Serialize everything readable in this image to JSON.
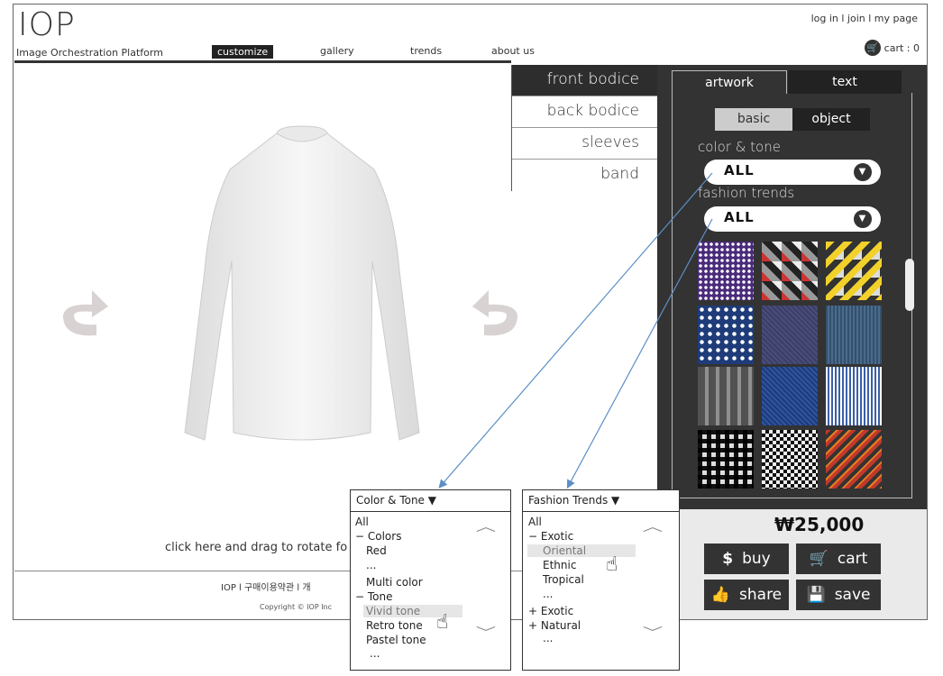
{
  "header": {
    "logo": "IOP",
    "logo_subtitle": "Image Orchestration Platform",
    "top_links": "log in l  join  l  my page",
    "cart_label": "cart : 0",
    "nav": [
      "customize",
      "gallery",
      "trends",
      "about us"
    ]
  },
  "parts": [
    "front bodice",
    "back bodice",
    "sleeves",
    "band"
  ],
  "panel": {
    "tab_artwork": "artwork",
    "tab_text": "text",
    "basic": "basic",
    "object": "object",
    "color_tone_label": "color & tone",
    "color_tone_value": "ALL",
    "fashion_label": "fashion trends",
    "fashion_value": "ALL"
  },
  "price": "₩25,000",
  "actions": {
    "buy": "buy",
    "cart": "cart",
    "share": "share",
    "save": "save"
  },
  "hint": "click here and drag to rotate fo",
  "footer": {
    "links": "IOP   l   구매이용약관   l   개",
    "copyright": "Copyright  © IOP Inc"
  },
  "dropdown_color": {
    "title": "Color & Tone  ▼",
    "items": [
      "All",
      "− Colors",
      "Red",
      "...",
      "Multi color",
      "− Tone",
      "Vivid tone",
      "Retro tone",
      "Pastel tone",
      "..."
    ]
  },
  "dropdown_fashion": {
    "title": "Fashion Trends  ▼",
    "items": [
      "All",
      "− Exotic",
      "Oriental",
      "Ethnic",
      "Tropical",
      "...",
      "+ Exotic",
      "+ Natural",
      "..."
    ]
  },
  "colors": {
    "dark_panel": "#333333",
    "accent_line": "#5b8fc7"
  }
}
